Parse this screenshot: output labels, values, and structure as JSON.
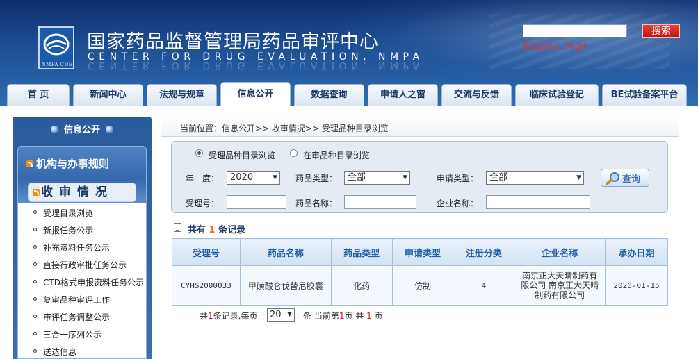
{
  "header": {
    "title_cn": "国家药品监督管理局药品审评中心",
    "title_en": "CENTER FOR DRUG EVALUATION, NMPA",
    "logo_caption": "NMPA CDE",
    "search_value": "",
    "search_button": "搜索",
    "english_link": "English Page"
  },
  "nav": {
    "tabs": [
      {
        "label": "首 页"
      },
      {
        "label": "新闻中心"
      },
      {
        "label": "法规与规章"
      },
      {
        "label": "信息公开"
      },
      {
        "label": "数据查询"
      },
      {
        "label": "申请人之窗"
      },
      {
        "label": "交流与反馈"
      },
      {
        "label": "临床试验登记"
      },
      {
        "label": "BE试验备案平台"
      }
    ],
    "active": "信息公开"
  },
  "sidebar": {
    "header": "信息公开",
    "group": "机构与办事规则",
    "section": "收审情况",
    "items": [
      {
        "label": "受理目录浏览"
      },
      {
        "label": "新报任务公示"
      },
      {
        "label": "补充资料任务公示"
      },
      {
        "label": "直接行政审批任务公示"
      },
      {
        "label": "CTD格式申报资料任务公示"
      },
      {
        "label": "复审品种审评工作"
      },
      {
        "label": "审评任务调整公示"
      },
      {
        "label": "三合一序列公示"
      },
      {
        "label": "送达信息"
      }
    ]
  },
  "breadcrumb": "当前位置：信息公开>> 收审情况>> 受理品种目录浏览",
  "filters": {
    "radio_1": "受理品种目录浏览",
    "radio_2": "在审品种目录浏览",
    "year_label": "年　度：",
    "year_value": "2020",
    "drug_type_label": "药品类型：",
    "drug_type_value": "全部",
    "apply_type_label": "申请类型：",
    "apply_type_value": "全部",
    "accept_no_label": "受理号：",
    "drug_name_label": "药品名称：",
    "company_label": "企业名称：",
    "query_button": "查询"
  },
  "records": {
    "prefix": "共有",
    "count": "1",
    "suffix": "条记录"
  },
  "table": {
    "headers": [
      "受理号",
      "药品名称",
      "药品类型",
      "申请类型",
      "注册分类",
      "企业名称",
      "承办日期"
    ],
    "rows": [
      {
        "accept_no": "CYHS2000033",
        "drug_name": "甲磺酸仑伐替尼胶囊",
        "drug_type": "化药",
        "apply_type": "仿制",
        "reg_class": "4",
        "company": "南京正大天晴制药有限公司 南京正大天晴制药有限公司",
        "date": "2020-01-15"
      }
    ]
  },
  "pager": {
    "text_1": "共",
    "total": "1",
    "text_2": "条记录,每页",
    "page_size": "20",
    "text_3": "条 当前第",
    "current": "1",
    "text_4": "页 共",
    "pages": "1",
    "text_5": "页"
  }
}
